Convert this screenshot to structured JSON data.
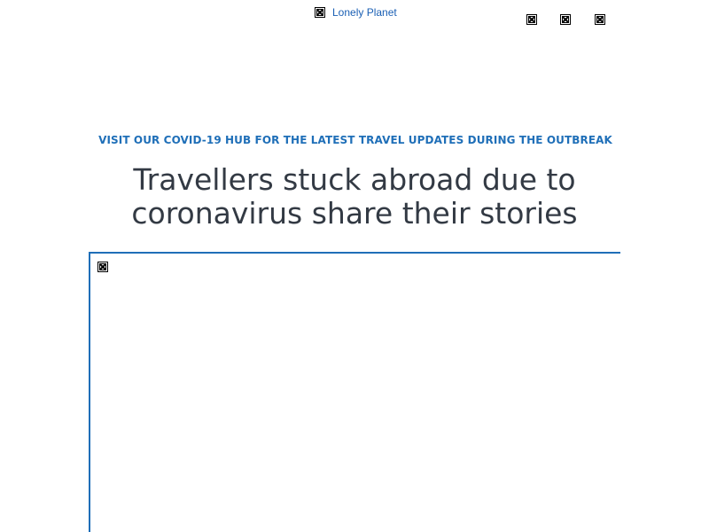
{
  "header": {
    "logo_text": "Lonely Planet",
    "logo_icon": "broken-image-icon",
    "right_icons": [
      "broken-image-icon",
      "broken-image-icon",
      "broken-image-icon"
    ]
  },
  "banner": {
    "text": "VISIT OUR COVID-19 HUB FOR THE LATEST TRAVEL UPDATES DURING THE OUTBREAK",
    "color": "#1f6fb8"
  },
  "article": {
    "title_line1": "Travellers stuck abroad due to",
    "title_line2": "coronavirus share their stories",
    "title_color": "#333a44",
    "media_icon": "broken-image-icon",
    "frame_color": "#1f6fb8"
  }
}
